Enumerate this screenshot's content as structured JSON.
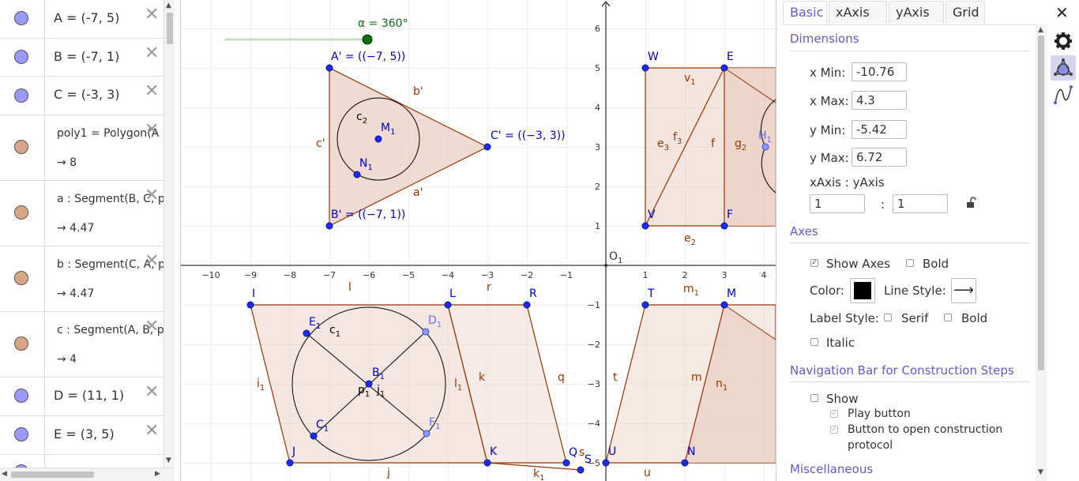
{
  "algebra": {
    "rows": [
      {
        "def": "A = (-7, 5)",
        "color": "#9999ff"
      },
      {
        "def": "B = (-7, 1)",
        "color": "#9999ff"
      },
      {
        "def": "C = (-3, 3)",
        "color": "#9999ff"
      },
      {
        "def": "poly1 = Polygon(A",
        "value": "→  8",
        "color": "#d8a589"
      },
      {
        "def": "a : Segment(B, C, p",
        "value": "→  4.47",
        "color": "#d8a589"
      },
      {
        "def": "b : Segment(C, A, p",
        "value": "→  4.47",
        "color": "#d8a589"
      },
      {
        "def": "c : Segment(A, B, p",
        "value": "→  4",
        "color": "#d8a589"
      },
      {
        "def": "D = (11, 1)",
        "color": "#9999ff"
      },
      {
        "def": "E = (3, 5)",
        "color": "#9999ff"
      }
    ],
    "delete_glyph": "✕"
  },
  "graphics": {
    "slider": {
      "label": "α = 360°"
    },
    "x_ticks": [
      "−10",
      "−9",
      "−8",
      "−7",
      "−6",
      "−5",
      "−4",
      "−3",
      "−2",
      "−1",
      "1",
      "2",
      "3",
      "4"
    ],
    "y_ticks": [
      "6",
      "5",
      "4",
      "3",
      "2",
      "1",
      "−1",
      "−2",
      "−3",
      "−4",
      "−5"
    ],
    "origin_label": "O",
    "origin_sub": "1",
    "points": {
      "A": "A' = ((−7, 5))",
      "B": "B' = ((−7, 1))",
      "C": "C' = ((−3, 3))"
    },
    "labels": {
      "b": "b'",
      "a": "a'",
      "c": "c'",
      "c2": "c",
      "c2s": "2",
      "M": "M",
      "Ms": "1",
      "N": "N",
      "Ns": "1",
      "W": "W",
      "E": "E",
      "V": "V",
      "F": "F",
      "H": "H",
      "Hs": "1",
      "v1": "v",
      "v1s": "1",
      "e3": "e",
      "e3s": "3",
      "e2": "e",
      "e2s": "2",
      "f3": "f",
      "f3s": "3",
      "f": "f",
      "g": "g",
      "g2": "g",
      "g2s": "2",
      "I": "I",
      "L": "L",
      "R": "R",
      "J": "J",
      "K": "K",
      "Q": "Q",
      "S": "S",
      "l": "l",
      "r": "r",
      "i1": "i",
      "i1s": "1",
      "l1": "l",
      "l1s": "1",
      "k": "k",
      "q": "q",
      "j": "j",
      "k1": "k",
      "k1s": "1",
      "s": "s",
      "E1": "E",
      "E1s": "1",
      "c1": "c",
      "c1s": "1",
      "D1": "D",
      "D1s": "1",
      "B1": "B",
      "B1s": "1",
      "p1": "p",
      "p1s": "1",
      "j1": "j",
      "j1s": "1",
      "C1": "C",
      "C1s": "1",
      "F1": "F",
      "F1s": "1",
      "T": "T",
      "M2": "M",
      "m1": "m",
      "m1s": "1",
      "U": "U",
      "N2": "N",
      "t": "t",
      "m": "m",
      "n1": "n",
      "n1s": "1",
      "u": "u"
    }
  },
  "props": {
    "tabs": [
      "Basic",
      "xAxis",
      "yAxis",
      "Grid"
    ],
    "dimensions": {
      "title": "Dimensions",
      "xmin_label": "x Min:",
      "xmin": "-10.76",
      "xmax_label": "x Max:",
      "xmax": "4.3",
      "ymin_label": "y Min:",
      "ymin": "-5.42",
      "ymax_label": "y Max:",
      "ymax": "6.72",
      "ratio_label": "xAxis : yAxis",
      "ratio_x": "1",
      "ratio_sep": ":",
      "ratio_y": "1"
    },
    "axes": {
      "title": "Axes",
      "show_axes": "Show Axes",
      "bold": "Bold",
      "color_label": "Color:",
      "color": "#000000",
      "line_style_label": "Line Style:",
      "line_style_glyph": "⟶",
      "label_style": "Label Style:",
      "serif": "Serif",
      "bold2": "Bold",
      "italic": "Italic"
    },
    "nav": {
      "title": "Navigation Bar for Construction Steps",
      "show": "Show",
      "play": "Play button",
      "protocol_1": "Button to open construction",
      "protocol_2": "protocol"
    },
    "misc_title": "Miscellaneous",
    "close_glyph": "✕",
    "checkmark": "✓"
  },
  "colors": {
    "point_blue": "#0000cc",
    "point_fill": "#1c2bff",
    "poly_stroke": "#993300",
    "poly_fill": "#e9cfc3",
    "label_brown": "#993300",
    "accent": "#6557d2",
    "grid": "#dddddd"
  }
}
